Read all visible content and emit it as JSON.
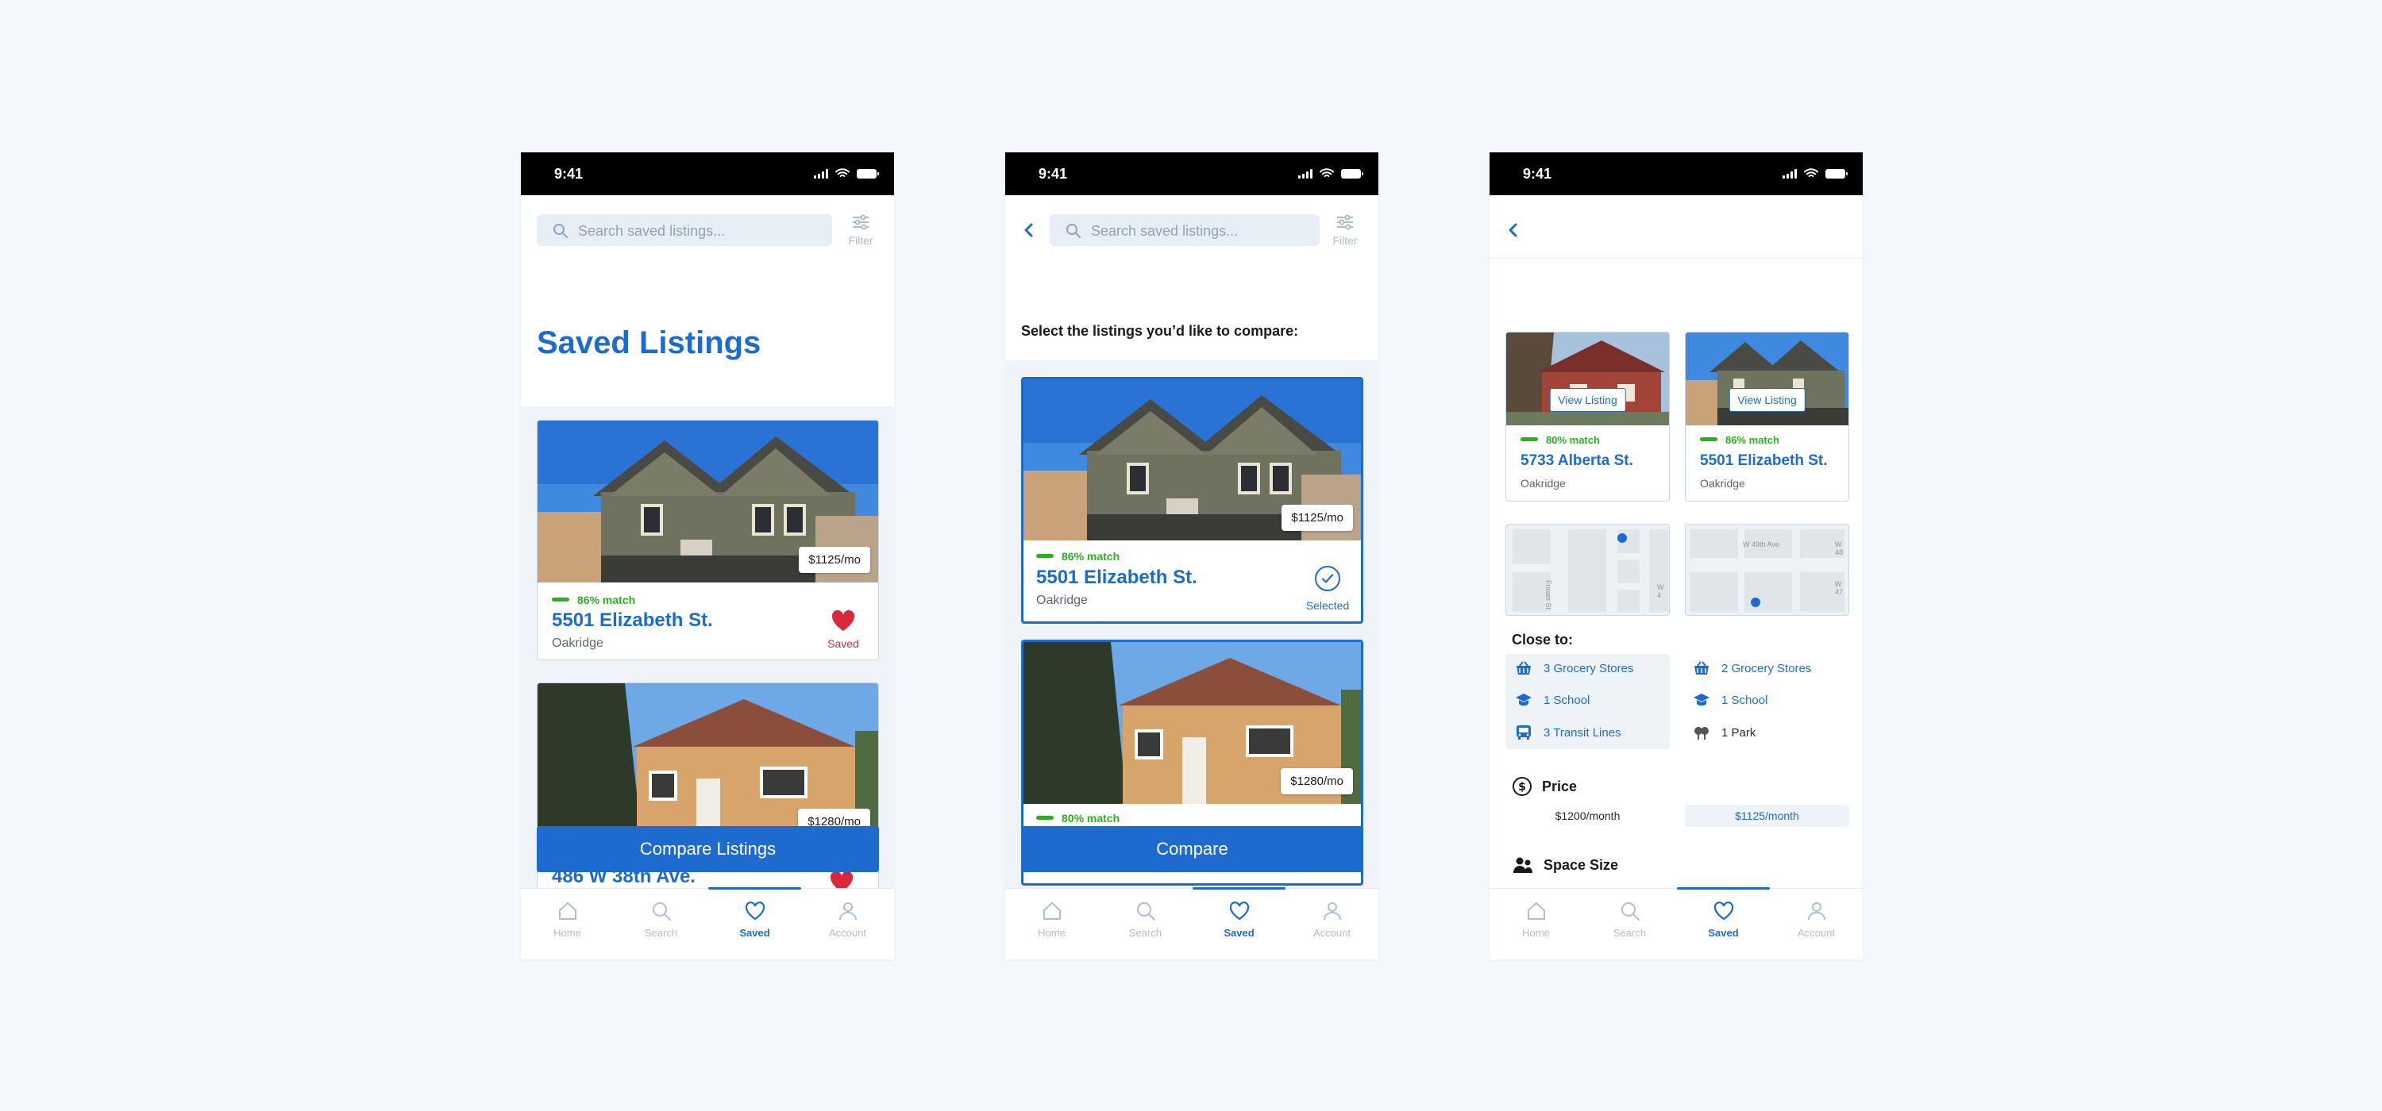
{
  "status": {
    "time": "9:41"
  },
  "search": {
    "placeholder": "Search saved listings...",
    "filter_label": "Filter"
  },
  "nav": {
    "items": [
      {
        "label": "Home"
      },
      {
        "label": "Search"
      },
      {
        "label": "Saved"
      },
      {
        "label": "Account"
      }
    ],
    "active": "Saved"
  },
  "colors": {
    "primary": "#1e6bd0",
    "match_green": "#2ab01f",
    "heart_red": "#d9283a",
    "status_bar": "#000000",
    "background": "#f5f8fb"
  },
  "screen1": {
    "title": "Saved Listings",
    "cards": [
      {
        "price": "$1125/mo",
        "match": "86% match",
        "address": "5501 Elizabeth St.",
        "neighborhood": "Oakridge",
        "saved_label": "Saved"
      },
      {
        "price": "$1280/mo",
        "address": "486 W 38th Ave."
      }
    ],
    "compare_button": "Compare Listings"
  },
  "screen2": {
    "prompt": "Select the listings you’d like to compare:",
    "cards": [
      {
        "price": "$1125/mo",
        "match": "86% match",
        "address": "5501 Elizabeth St.",
        "neighborhood": "Oakridge",
        "selected_label": "Selected"
      },
      {
        "price": "$1280/mo",
        "match": "80% match"
      }
    ],
    "compare_button": "Compare"
  },
  "screen3": {
    "view_listing": "View Listing",
    "listings": [
      {
        "match": "80% match",
        "address": "5733 Alberta St.",
        "neighborhood": "Oakridge"
      },
      {
        "match": "86% match",
        "address": "5501 Elizabeth St.",
        "neighborhood": "Oakridge"
      }
    ],
    "maps": [
      {
        "street_labels": [
          "Fraser St",
          "W 4"
        ]
      },
      {
        "street_labels": [
          "W 49th Ave",
          "W 48",
          "W 47"
        ]
      }
    ],
    "close_to_title": "Close to:",
    "close_to": [
      [
        {
          "label": "3 Grocery Stores",
          "icon": "basket-icon"
        },
        {
          "label": "1 School",
          "icon": "school-icon"
        },
        {
          "label": "3 Transit Lines",
          "icon": "bus-icon"
        }
      ],
      [
        {
          "label": "2 Grocery Stores",
          "icon": "basket-icon"
        },
        {
          "label": "1 School",
          "icon": "school-icon"
        },
        {
          "label": "1 Park",
          "icon": "tree-icon"
        }
      ]
    ],
    "price_title": "Price",
    "prices": [
      "$1200/month",
      "$1125/month"
    ],
    "space_title": "Space Size"
  }
}
